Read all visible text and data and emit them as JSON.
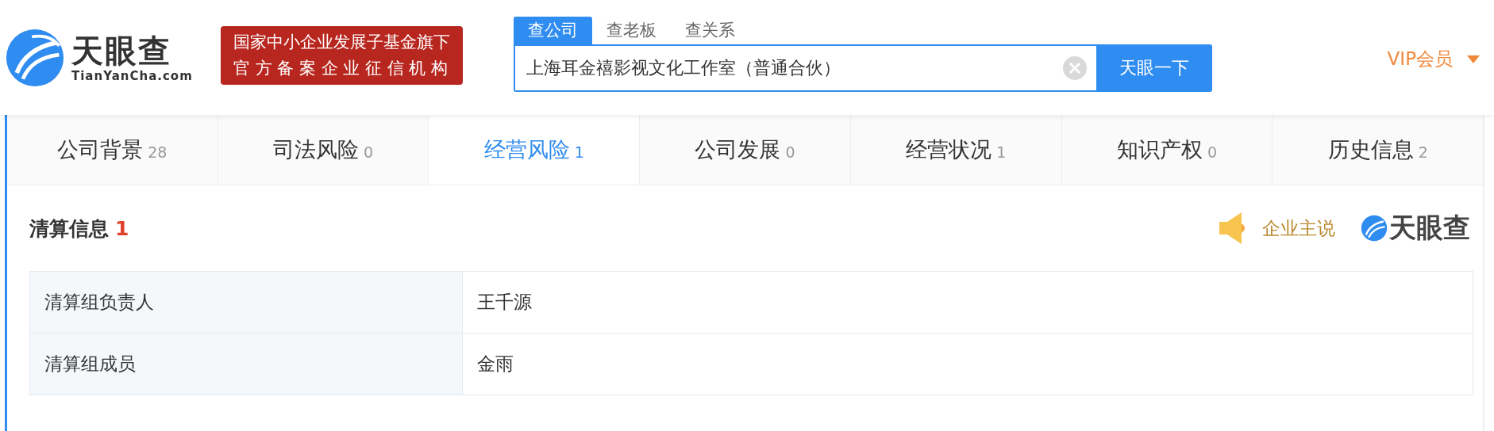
{
  "header": {
    "logo": {
      "name": "天眼查",
      "domain": "TianYanCha.com"
    },
    "banner": [
      "国家中小企业发展子基金旗下",
      "官 方 备 案 企 业 征 信 机 构"
    ],
    "search": {
      "tabs": [
        {
          "label": "查公司",
          "selected": true
        },
        {
          "label": "查老板",
          "selected": false
        },
        {
          "label": "查关系",
          "selected": false
        }
      ],
      "value": "上海耳金禧影视文化工作室（普通合伙）",
      "button": "天眼一下"
    },
    "vip": "VIP会员"
  },
  "nav_tabs": [
    {
      "label": "公司背景",
      "count": "28",
      "selected": false
    },
    {
      "label": "司法风险",
      "count": "0",
      "selected": false
    },
    {
      "label": "经营风险",
      "count": "1",
      "selected": true
    },
    {
      "label": "公司发展",
      "count": "0",
      "selected": false
    },
    {
      "label": "经营状况",
      "count": "1",
      "selected": false
    },
    {
      "label": "知识产权",
      "count": "0",
      "selected": false
    },
    {
      "label": "历史信息",
      "count": "2",
      "selected": false
    }
  ],
  "section": {
    "title": "清算信息",
    "count": "1",
    "speaker_label": "企业主说",
    "brand": "天眼查",
    "rows": [
      {
        "label": "清算组负责人",
        "value": "王千源"
      },
      {
        "label": "清算组成员",
        "value": "金雨"
      }
    ]
  }
}
